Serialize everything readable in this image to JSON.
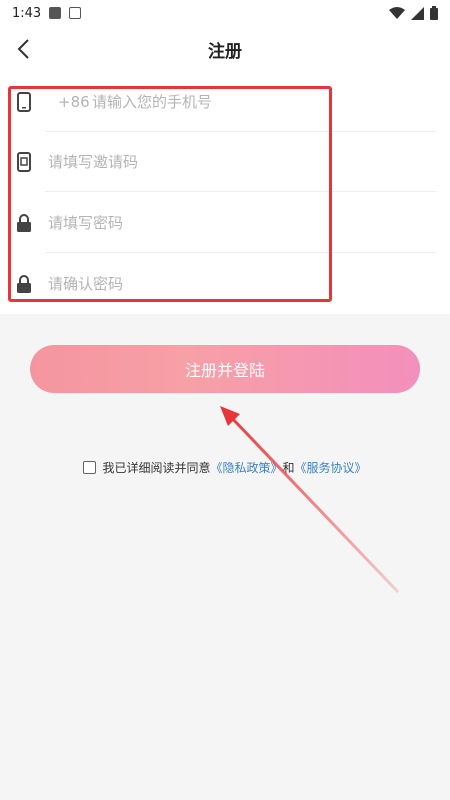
{
  "status_bar": {
    "time": "1:43"
  },
  "header": {
    "title": "注册"
  },
  "form": {
    "phone_prefix": "+86",
    "phone_placeholder": "请输入您的手机号",
    "invite_placeholder": "请填写邀请码",
    "password_placeholder": "请填写密码",
    "confirm_placeholder": "请确认密码"
  },
  "submit": {
    "label": "注册并登陆"
  },
  "agreement": {
    "text": "我已详细阅读并同意",
    "privacy_link": "《隐私政策》",
    "and": "和",
    "service_link": "《服务协议》"
  },
  "colors": {
    "highlight": "#e8353a",
    "link": "#3b82c4",
    "button_start": "#f5959f",
    "button_end": "#f38fbc"
  },
  "icons": [
    "back-arrow-icon",
    "phone-icon",
    "invite-code-icon",
    "lock-icon",
    "wifi-icon",
    "signal-icon",
    "battery-icon"
  ]
}
